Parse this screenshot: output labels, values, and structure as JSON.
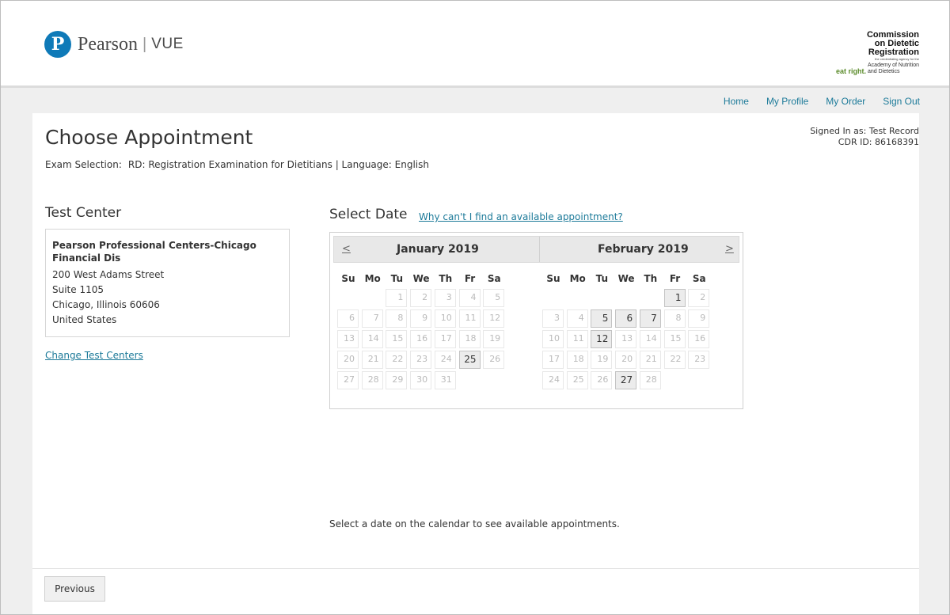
{
  "header": {
    "logo_mark": "P",
    "logo_word": "Pearson",
    "logo_sep": "|",
    "logo_vue": "VUE",
    "partner": {
      "line1": "Commission",
      "line2": "on Dietetic",
      "line3": "Registration",
      "tagline": "the credentialing agency for the",
      "brand": "eat right.",
      "academy1": "Academy of Nutrition",
      "academy2": "and Dietetics"
    }
  },
  "nav": {
    "home": "Home",
    "profile": "My Profile",
    "order": "My Order",
    "signout": "Sign Out"
  },
  "page": {
    "title": "Choose Appointment",
    "exam_label": "Exam Selection:",
    "exam_value": "RD: Registration Examination for Dietitians | Language: English",
    "signed_in": "Signed In as: Test Record",
    "cdr_id": "CDR ID: 86168391"
  },
  "test_center": {
    "heading": "Test Center",
    "name": "Pearson Professional Centers-Chicago Financial Dis",
    "address1": "200 West Adams Street",
    "address2": "Suite 1105",
    "city": "Chicago, Illinois 60606",
    "country": "United States",
    "change_link": "Change Test Centers"
  },
  "select_date": {
    "heading": "Select Date",
    "help_link": "Why can't I find an available appointment?",
    "prev": "<",
    "next": ">",
    "weekdays": [
      "Su",
      "Mo",
      "Tu",
      "We",
      "Th",
      "Fr",
      "Sa"
    ],
    "months": [
      {
        "name": "January 2019",
        "first_weekday": 2,
        "days_in_month": 31,
        "available": [
          25
        ]
      },
      {
        "name": "February 2019",
        "first_weekday": 5,
        "days_in_month": 28,
        "available": [
          1,
          5,
          6,
          7,
          12,
          27
        ]
      }
    ],
    "hint": "Select a date on the calendar to see available appointments."
  },
  "footer": {
    "previous": "Previous"
  }
}
